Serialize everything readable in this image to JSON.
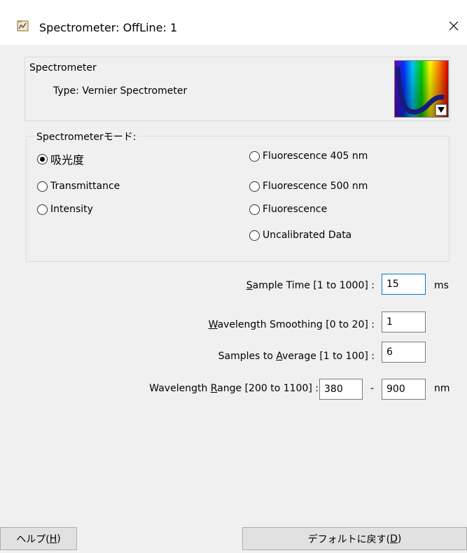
{
  "window": {
    "title": "Spectrometer: OffLine: 1"
  },
  "info": {
    "title": "Spectrometer",
    "type": "Type: Vernier Spectrometer"
  },
  "mode": {
    "legend": "Spectrometerモード:",
    "options": [
      {
        "label": "吸光度",
        "selected": true
      },
      {
        "label": "Transmittance",
        "selected": false
      },
      {
        "label": "Intensity",
        "selected": false
      },
      {
        "label": "Fluorescence 405 nm",
        "selected": false
      },
      {
        "label": "Fluorescence 500 nm",
        "selected": false
      },
      {
        "label": "Fluorescence",
        "selected": false
      },
      {
        "label": "Uncalibrated Data",
        "selected": false
      }
    ]
  },
  "fields": {
    "sample_time": {
      "pre": "",
      "key": "S",
      "post": "ample Time [1 to 1000] :",
      "value": "15",
      "unit": "ms"
    },
    "smoothing": {
      "pre": "",
      "key": "W",
      "post": "avelength Smoothing [0 to 20] :",
      "value": "1"
    },
    "average": {
      "pre": "Samples to ",
      "key": "A",
      "post": "verage [1 to 100] :",
      "value": "6"
    },
    "range": {
      "pre": "Wavelength ",
      "key": "R",
      "post": "ange [200 to 1100] :",
      "min": "380",
      "sep": "-",
      "max": "900",
      "unit": "nm"
    }
  },
  "buttons": {
    "help": {
      "pre": "ヘルプ(",
      "key": "H",
      "post": ")"
    },
    "default": {
      "pre": "デフォルトに戻す(",
      "key": "D",
      "post": ")"
    }
  },
  "colors": {
    "accent_focus": "#0078d7",
    "dialog_bg": "#f0f0f0",
    "button_bg": "#e1e1e1"
  }
}
